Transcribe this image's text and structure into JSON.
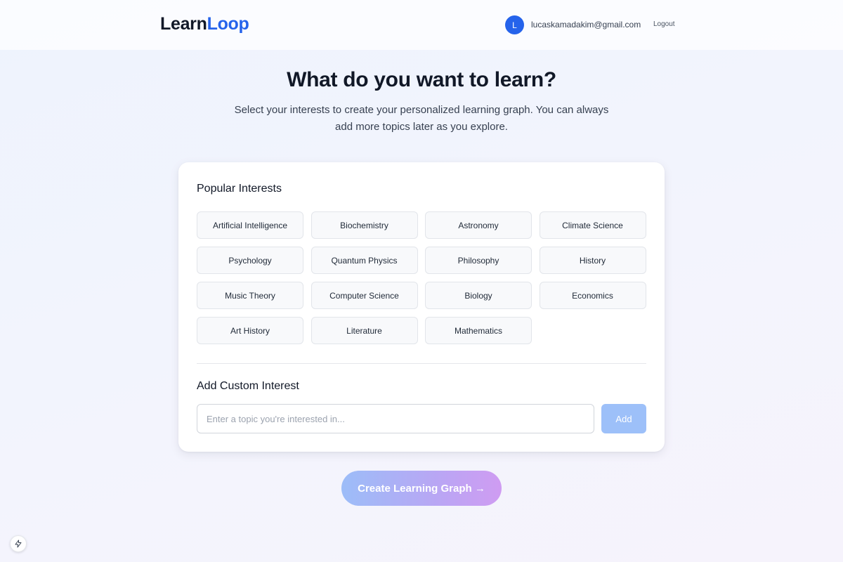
{
  "header": {
    "logo_part1": "Learn",
    "logo_part2": "Loop",
    "avatar_initial": "L",
    "email": "lucaskamadakim@gmail.com",
    "logout_label": "Logout"
  },
  "hero": {
    "title": "What do you want to learn?",
    "subtitle": "Select your interests to create your personalized learning graph. You can always add more topics later as you explore."
  },
  "interests": {
    "heading": "Popular Interests",
    "items": [
      "Artificial Intelligence",
      "Biochemistry",
      "Astronomy",
      "Climate Science",
      "Psychology",
      "Quantum Physics",
      "Philosophy",
      "History",
      "Music Theory",
      "Computer Science",
      "Biology",
      "Economics",
      "Art History",
      "Literature",
      "Mathematics"
    ]
  },
  "custom": {
    "heading": "Add Custom Interest",
    "placeholder": "Enter a topic you're interested in...",
    "value": "",
    "add_label": "Add"
  },
  "cta": {
    "label": "Create Learning Graph →"
  },
  "icons": {
    "floating_button": "lightning-bolt-icon"
  },
  "colors": {
    "accent": "#2563eb",
    "add_button_disabled": "#9dc0f9",
    "cta_gradient_start": "#9cbdf8",
    "cta_gradient_end": "#cf9cf2"
  }
}
